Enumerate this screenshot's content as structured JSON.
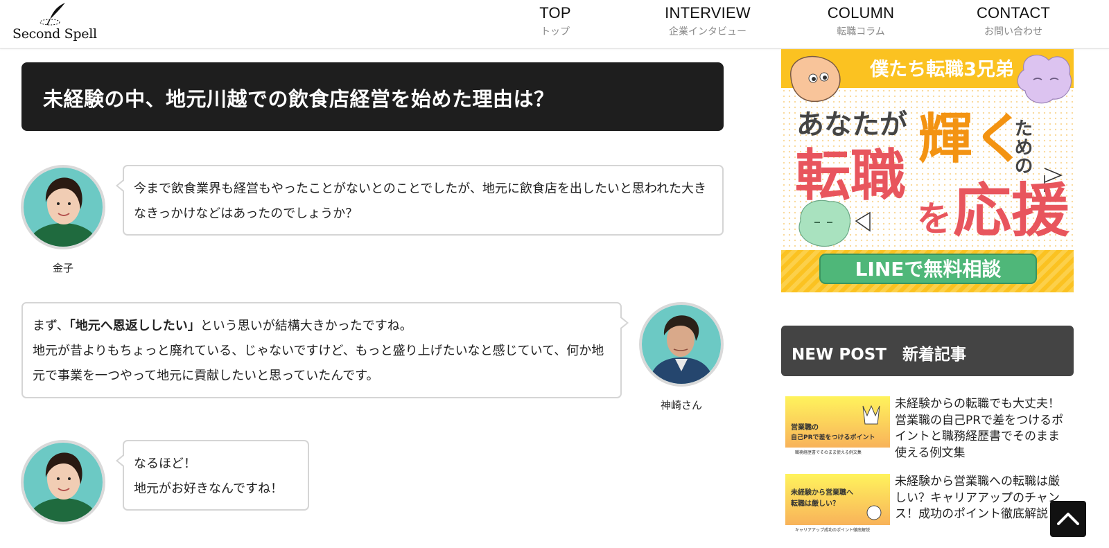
{
  "header": {
    "logo_text": "Second Spell",
    "nav": [
      {
        "en": "TOP",
        "ja": "トップ"
      },
      {
        "en": "INTERVIEW",
        "ja": "企業インタビュー"
      },
      {
        "en": "COLUMN",
        "ja": "転職コラム"
      },
      {
        "en": "CONTACT",
        "ja": "お問い合わせ"
      }
    ]
  },
  "main": {
    "section_title": "未経験の中、地元川越での飲食店経営を始めた理由は？",
    "dialog": [
      {
        "speaker": "金子",
        "lines": [
          "今まで飲食業界も経営もやったことがないとのことでしたが、地元に飲食店を出したいと思われた大きなきっかけなどはあったのでしょうか？"
        ]
      },
      {
        "speaker": "神崎さん",
        "line1_before": "まず、",
        "line1_bold": "「地元へ恩返ししたい」",
        "line1_after": "という思いが結構大きかったですね。",
        "line2": "地元が昔よりもちょっと廃れている、じゃないですけど、もっと盛り上げたいなと感じていて、何か地元で事業を一つやって地元に貢献したいと思っていたんです。"
      },
      {
        "speaker": "金子",
        "lines": [
          "なるほど！",
          "地元がお好きなんですね！"
        ]
      }
    ]
  },
  "sidebar": {
    "banner": {
      "top": "僕たち転職3兄弟",
      "anata": "あなたが",
      "kagayaku": "輝く",
      "tame": "ための",
      "tenshoku": "転職",
      "wo": "を",
      "ouen": "応援",
      "cta": "LINEで無料相談"
    },
    "new_post_heading": "NEW POST　新着記事",
    "posts": [
      {
        "title": "未経験からの転職でも大丈夫！営業職の自己PRで差をつけるポイントと職務経歴書でそのまま使える例文集",
        "thumb_line1": "営業職の",
        "thumb_line2": "自己PRで差をつけるポイント",
        "thumb_foot": "職務経歴書でそのまま使える例文集"
      },
      {
        "title": "未経験から営業職への転職は厳しい？キャリアアップのチャンス！成功のポイント徹底解説",
        "thumb_line1": "未経験から営業職へ",
        "thumb_line2": "転職は厳しい？",
        "thumb_foot": "キャリアアップ成功のポイント徹底解説"
      }
    ]
  },
  "colors": {
    "title_bg": "#1e1e1e",
    "bubble_border": "#d5d5d5",
    "banner_yellow": "#fbc221",
    "banner_red": "#e8555d",
    "banner_orange": "#f39312",
    "cta_green": "#4fb779",
    "sidebar_head_bg": "#444444"
  },
  "icons": {
    "logo": "quill-pen-icon",
    "scroll_top": "chevron-up-icon"
  }
}
